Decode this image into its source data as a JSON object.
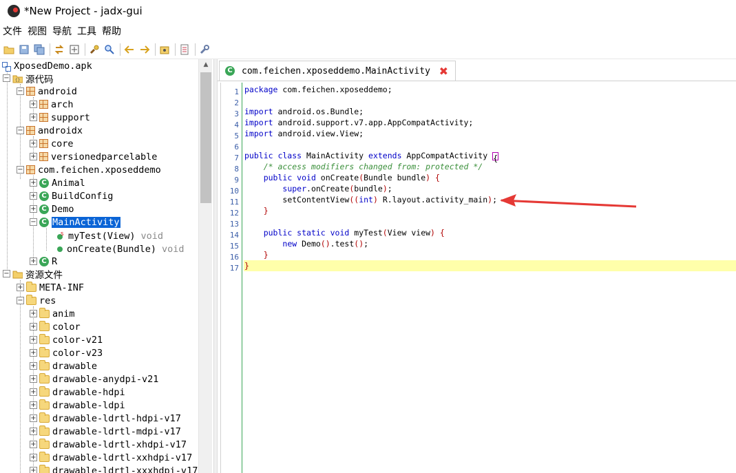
{
  "window": {
    "title": "*New Project - jadx-gui"
  },
  "menu": {
    "items": [
      "文件",
      "视图",
      "导航",
      "工具",
      "帮助"
    ]
  },
  "toolbar": {
    "buttons": [
      "open-icon",
      "save-icon",
      "save-all-icon",
      "sync-icon",
      "expand-icon",
      "find-icon",
      "search-icon",
      "back-icon",
      "forward-icon",
      "deobf-icon",
      "log-icon",
      "preferences-icon"
    ]
  },
  "tree": {
    "apk": "XposedDemo.apk",
    "sources": "源代码",
    "android": "android",
    "arch": "arch",
    "support": "support",
    "androidx": "androidx",
    "core": "core",
    "versionedparcelable": "versionedparcelable",
    "app_pkg": "com.feichen.xposeddemo",
    "animal": "Animal",
    "buildconfig": "BuildConfig",
    "demo": "Demo",
    "mainactivity": "MainActivity",
    "mytest": "myTest(View)",
    "mytest_ret": "void",
    "oncreate": "onCreate(Bundle)",
    "oncreate_ret": "void",
    "r": "R",
    "resources": "资源文件",
    "metainf": "META-INF",
    "res": "res",
    "res_dirs": [
      "anim",
      "color",
      "color-v21",
      "color-v23",
      "drawable",
      "drawable-anydpi-v21",
      "drawable-hdpi",
      "drawable-ldpi",
      "drawable-ldrtl-hdpi-v17",
      "drawable-ldrtl-mdpi-v17",
      "drawable-ldrtl-xhdpi-v17",
      "drawable-ldrtl-xxhdpi-v17",
      "drawable-ldrtl-xxxhdpi-v17"
    ]
  },
  "editor": {
    "tab_title": "com.feichen.xposeddemo.MainActivity",
    "line_numbers": [
      "1",
      "2",
      "3",
      "4",
      "5",
      "6",
      "7",
      "8",
      "9",
      "10",
      "11",
      "12",
      "13",
      "14",
      "15",
      "16",
      "17"
    ],
    "code": {
      "l1_kw": "package",
      "l1_rest": " com.feichen.xposeddemo;",
      "l3_kw": "import",
      "l3_rest": " android.os.Bundle;",
      "l4_kw": "import",
      "l4_rest": " android.support.v7.app.AppCompatActivity;",
      "l5_kw": "import",
      "l5_rest": " android.view.View;",
      "l7_kw1": "public class",
      "l7_name": " MainActivity ",
      "l7_kw2": "extends",
      "l7_rest": " AppCompatActivity ",
      "l7_brace": "{",
      "l8_comment": "    /* access modifiers changed from: protected */",
      "l9_indent": "    ",
      "l9_kw": "public void",
      "l9_rest": " onCreate",
      "l9_p1": "(",
      "l9_args": "Bundle bundle",
      "l9_p2": ")",
      "l9_brace": " {",
      "l10_indent": "        ",
      "l10_kw": "super",
      "l10_rest": ".onCreate",
      "l10_p1": "(",
      "l10_args": "bundle",
      "l10_p2": ")",
      "l10_end": ";",
      "l11_indent": "        ",
      "l11_rest": "setContentView",
      "l11_p1": "((",
      "l11_kw": "int",
      "l11_p2": ")",
      "l11_args": " R.layout.activity_main",
      "l11_p3": ")",
      "l11_end": ";",
      "l12_brace": "    }",
      "l14_indent": "    ",
      "l14_kw": "public static void",
      "l14_rest": " myTest",
      "l14_p1": "(",
      "l14_args": "View view",
      "l14_p2": ")",
      "l14_brace": " {",
      "l15_indent": "        ",
      "l15_kw": "new",
      "l15_rest": " Demo",
      "l15_p1": "()",
      "l15_mid": ".test",
      "l15_p2": "()",
      "l15_end": ";",
      "l16_brace": "    }",
      "l17_brace": "}"
    }
  },
  "colors": {
    "selection": "#0a64d6",
    "keyword": "#0000c8",
    "comment": "#3a8f3a",
    "current_line": "#ffffaa",
    "annotation_arrow": "#e53935"
  }
}
